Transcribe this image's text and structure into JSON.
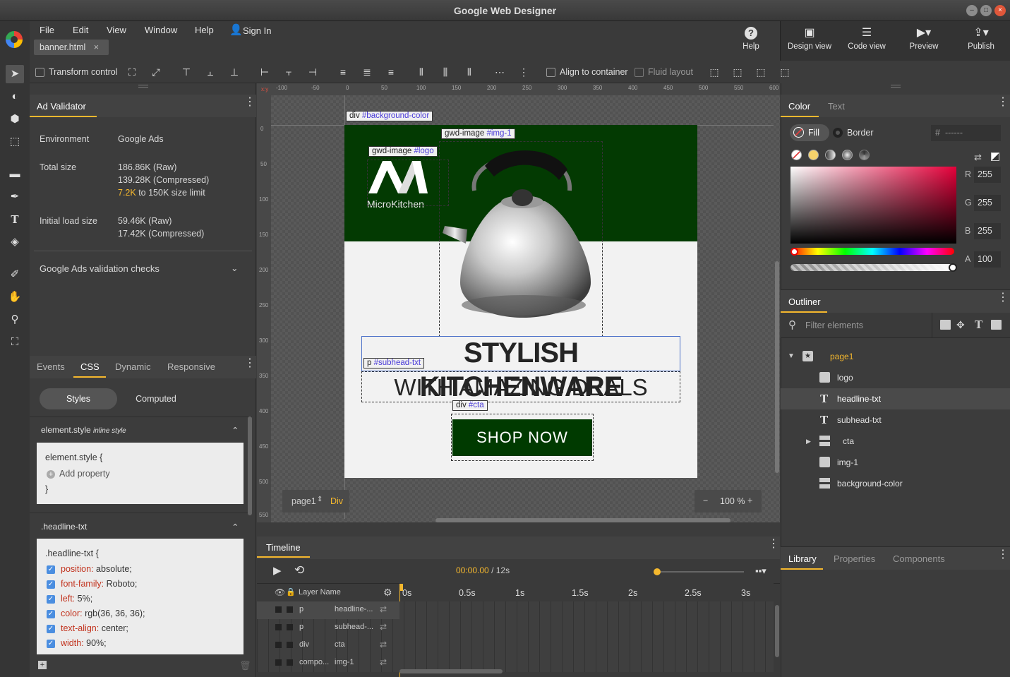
{
  "app": {
    "title": "Google Web Designer"
  },
  "menu": {
    "file": "File",
    "edit": "Edit",
    "view": "View",
    "window": "Window",
    "help": "Help",
    "sign_in": "Sign In"
  },
  "document_tab": {
    "name": "banner.html",
    "close": "×"
  },
  "top_buttons": {
    "help": "Help",
    "design_view": "Design view",
    "code_view": "Code view",
    "preview": "Preview",
    "publish": "Publish"
  },
  "toolbar": {
    "transform_control": "Transform control",
    "align_to_container": "Align to container",
    "fluid_layout": "Fluid layout"
  },
  "ad_validator": {
    "title": "Ad Validator",
    "environment_label": "Environment",
    "environment_value": "Google Ads",
    "total_size_label": "Total size",
    "total_raw": "186.86K (Raw)",
    "total_compressed": "139.28K (Compressed)",
    "size_used": "7.2K",
    "size_limit_text": "to 150K size limit",
    "initial_load_label": "Initial load size",
    "initial_raw": "59.46K (Raw)",
    "initial_compressed": "17.42K (Compressed)",
    "checks_label": "Google Ads validation checks"
  },
  "css_panel": {
    "tabs": [
      "Events",
      "CSS",
      "Dynamic",
      "Responsive"
    ],
    "styles": "Styles",
    "computed": "Computed",
    "element_style_header": "element.style",
    "element_style_note": "inline style",
    "element_style_open": "element.style  {",
    "add_property": "Add property",
    "close_brace": "}",
    "rule_header": ".headline-txt",
    "rule_open": ".headline-txt  {",
    "properties": [
      {
        "name": "position:",
        "value": "absolute;"
      },
      {
        "name": "font-family:",
        "value": "Roboto;"
      },
      {
        "name": "left:",
        "value": "5%;"
      },
      {
        "name": "color:",
        "value": "rgb(36, 36, 36);"
      },
      {
        "name": "text-align:",
        "value": "center;"
      },
      {
        "name": "width:",
        "value": "90%;"
      }
    ]
  },
  "rulers": {
    "top": [
      "-100",
      "-50",
      "0",
      "50",
      "100",
      "150",
      "200",
      "250",
      "300",
      "350",
      "400",
      "450",
      "500",
      "550",
      "600"
    ],
    "left": [
      "0",
      "50",
      "100",
      "150",
      "200",
      "250",
      "300",
      "350",
      "400",
      "450",
      "500",
      "550"
    ]
  },
  "stage": {
    "tag_background": {
      "el": "div",
      "id": "#background-color"
    },
    "tag_img1": {
      "el": "gwd-image",
      "id": "#img-1"
    },
    "tag_logo": {
      "el": "gwd-image",
      "id": "#logo"
    },
    "tag_subhead": {
      "el": "p",
      "id": "#subhead-txt"
    },
    "tag_cta": {
      "el": "div",
      "id": "#cta"
    },
    "logo_text": "MicroKitchen",
    "headline": "STYLISH KITCHENWARE",
    "subhead": "WITH AMAZING DEALS",
    "cta": "SHOP NOW",
    "page_selector": "page1",
    "element_type": "Div",
    "zoom": "100 %",
    "zoom_minus": "−",
    "zoom_plus": "+"
  },
  "timeline": {
    "title": "Timeline",
    "time": "00:00.00",
    "duration": "/ 12s",
    "layer_name_header": "Layer Name",
    "ticks": [
      "0s",
      "0.5s",
      "1s",
      "1.5s",
      "2s",
      "2.5s",
      "3s"
    ],
    "layers": [
      {
        "type": "p",
        "name": "headline-..."
      },
      {
        "type": "p",
        "name": "subhead-..."
      },
      {
        "type": "div",
        "name": "cta"
      },
      {
        "type": "compo...",
        "name": "img-1"
      }
    ]
  },
  "color_panel": {
    "tabs": [
      "Color",
      "Text"
    ],
    "fill": "Fill",
    "border": "Border",
    "hex_prefix": "#",
    "hex_value": "------",
    "r_label": "R",
    "r": "255",
    "g_label": "G",
    "g": "255",
    "b_label": "B",
    "b": "255",
    "a_label": "A",
    "a": "100"
  },
  "outliner": {
    "title": "Outliner",
    "filter_placeholder": "Filter elements",
    "items": [
      {
        "label": "page1"
      },
      {
        "label": "logo"
      },
      {
        "label": "headline-txt"
      },
      {
        "label": "subhead-txt"
      },
      {
        "label": "cta"
      },
      {
        "label": "img-1"
      },
      {
        "label": "background-color"
      }
    ]
  },
  "bottom_tabs": [
    "Library",
    "Properties",
    "Components"
  ],
  "colors": {
    "accent": "#f5b82e",
    "banner_green": "#033a02",
    "cta_green": "#003a00",
    "id_purple": "#4a3bd8"
  }
}
